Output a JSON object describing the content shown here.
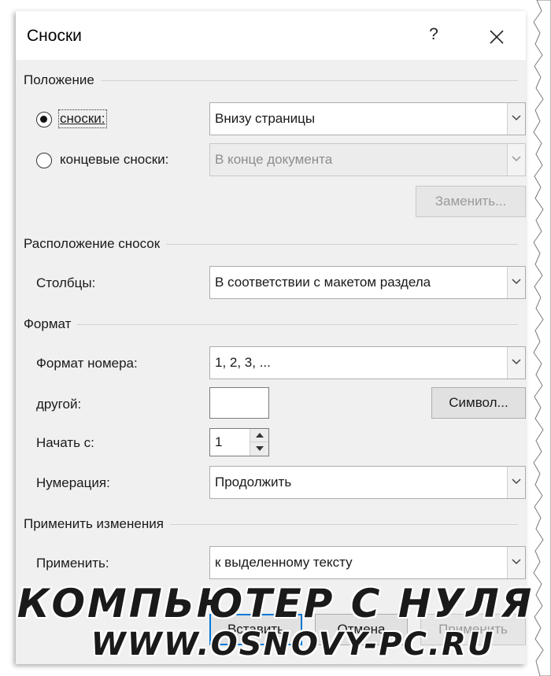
{
  "dialog": {
    "title": "Сноски",
    "help_label": "?"
  },
  "position_section": {
    "heading": "Положение",
    "footnotes_label": "сноски:",
    "footnotes_value": "Внизу страницы",
    "endnotes_label": "концевые сноски:",
    "endnotes_value": "В конце документа",
    "replace_button": "Заменить..."
  },
  "layout_section": {
    "heading": "Расположение сносок",
    "columns_label": "Столбцы:",
    "columns_value": "В соответствии с макетом раздела"
  },
  "format_section": {
    "heading": "Формат",
    "number_format_label": "Формат номера:",
    "number_format_value": "1, 2, 3, ...",
    "custom_label": "другой:",
    "custom_value": "",
    "symbol_button": "Символ...",
    "start_at_label": "Начать с:",
    "start_at_value": "1",
    "numbering_label": "Нумерация:",
    "numbering_value": "Продолжить"
  },
  "apply_section": {
    "heading": "Применить изменения",
    "apply_to_label": "Применить:",
    "apply_to_value": "к выделенному тексту"
  },
  "buttons": {
    "insert": "Вставить",
    "cancel": "Отмена",
    "apply": "Применить"
  },
  "watermark": {
    "line1": "КОМПЬЮТЕР С НУЛЯ",
    "line2": "WWW.OSNOVY-PC.RU"
  },
  "state": {
    "footnotes_selected": true,
    "endnotes_selected": false,
    "endnotes_enabled": false,
    "replace_enabled": false,
    "apply_enabled": false
  },
  "colors": {
    "dialog_bg": "#f0f0f0",
    "default_button_border": "#0078d7"
  }
}
